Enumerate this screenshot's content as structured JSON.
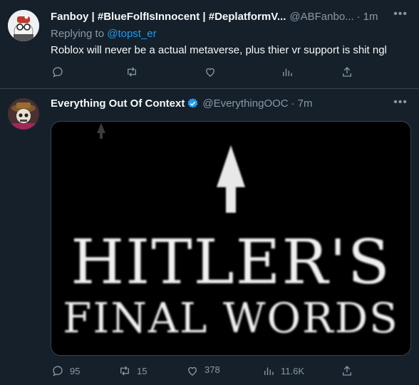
{
  "tweets": [
    {
      "display_name": "Fanboy | #BlueFolfIsInnocent | #DeplatformV...",
      "handle": "@ABFanbo...",
      "time": "1m",
      "replying_prefix": "Replying to",
      "replying_to": "@topst_er",
      "text": "Roblox will never be a actual metaverse, plus thier vr support is shit ngl",
      "stats": {
        "replies": "",
        "retweets": "",
        "likes": "",
        "views": ""
      }
    },
    {
      "display_name": "Everything Out Of Context",
      "handle": "@EverythingOOC",
      "time": "7m",
      "verified": true,
      "media": {
        "line1": "HITLER'S",
        "line2": "FINAL WORDS"
      },
      "stats": {
        "replies": "95",
        "retweets": "15",
        "likes": "378",
        "views": "11.6K"
      }
    }
  ],
  "icons": [
    "more-icon",
    "reply-icon",
    "retweet-icon",
    "like-icon",
    "views-icon",
    "share-icon",
    "verified-badge-icon"
  ],
  "colors": {
    "background": "#15202b",
    "text": "#f7f9f9",
    "muted": "#8b98a5",
    "accent": "#1d9bf0",
    "divider": "#38444d"
  }
}
